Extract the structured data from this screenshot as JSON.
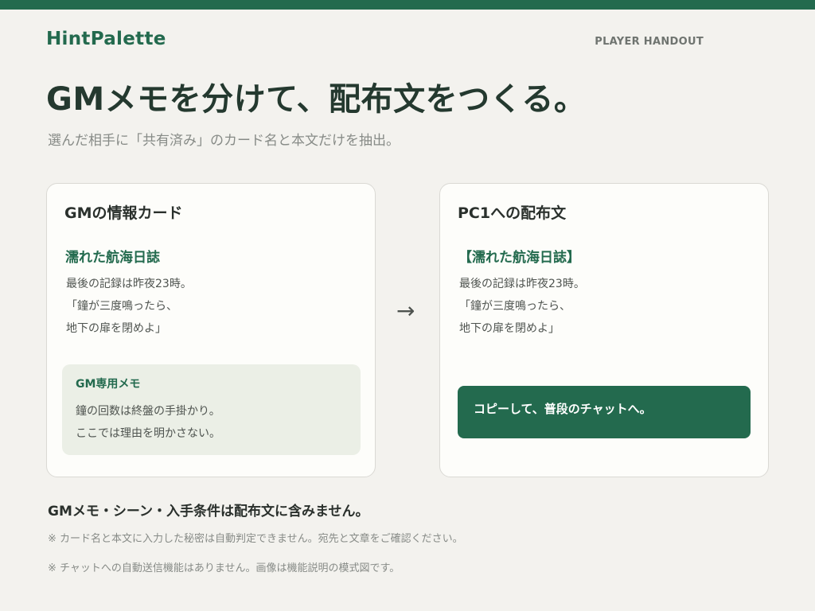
{
  "brand": "HintPalette",
  "handout_label": "PLAYER HANDOUT",
  "headline": "GMメモを分けて、配布文をつくる。",
  "subline": "選んだ相手に「共有済み」のカード名と本文だけを抽出。",
  "gm_card": {
    "title": "GMの情報カード",
    "item_name": "濡れた航海日誌",
    "body": [
      "最後の記録は昨夜23時。",
      "「鐘が三度鳴ったら、",
      "地下の扉を閉めよ」"
    ],
    "memo": {
      "title": "GM専用メモ",
      "lines": [
        "鐘の回数は終盤の手掛かり。",
        "ここでは理由を明かさない。"
      ]
    }
  },
  "arrow": "→",
  "pc_card": {
    "title": "PC1への配布文",
    "item_name": "【濡れた航海日誌】",
    "body": [
      "最後の記録は昨夜23時。",
      "「鐘が三度鳴ったら、",
      "地下の扉を閉めよ」"
    ],
    "copy_button": "コピーして、普段のチャットへ。"
  },
  "footer": {
    "note": "GMメモ・シーン・入手条件は配布文に含みません。",
    "caveats": [
      "※ カード名と本文に入力した秘密は自動判定できません。宛先と文章をご確認ください。",
      "※ チャットへの自動送信機能はありません。画像は機能説明の模式図です。"
    ]
  },
  "colors": {
    "accent": "#236a4e",
    "background": "#f3f2ee",
    "card": "#fdfdfa",
    "memo_bg": "#ebefe6"
  }
}
